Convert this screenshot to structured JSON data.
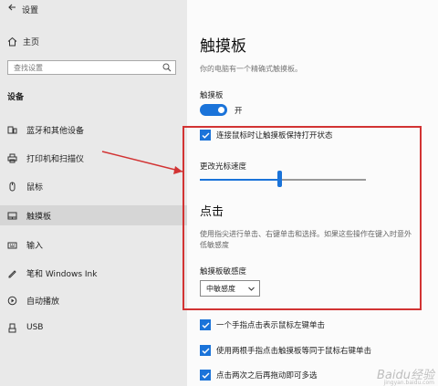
{
  "window": {
    "title": "设置"
  },
  "sidebar": {
    "home": "主页",
    "search_placeholder": "查找设置",
    "section": "设备",
    "items": [
      {
        "label": "蓝牙和其他设备",
        "icon": "bluetooth-devices-icon"
      },
      {
        "label": "打印机和扫描仪",
        "icon": "printer-icon"
      },
      {
        "label": "鼠标",
        "icon": "mouse-icon"
      },
      {
        "label": "触摸板",
        "icon": "touchpad-icon",
        "selected": true
      },
      {
        "label": "输入",
        "icon": "keyboard-icon"
      },
      {
        "label": "笔和 Windows Ink",
        "icon": "pen-icon"
      },
      {
        "label": "自动播放",
        "icon": "autoplay-icon"
      },
      {
        "label": "USB",
        "icon": "usb-icon"
      }
    ]
  },
  "main": {
    "title": "触摸板",
    "subtitle": "你的电脑有一个精确式触摸板。",
    "touchpad_label": "触摸板",
    "toggle_state": "开",
    "keep_on_with_mouse": "连接鼠标时让触摸板保持打开状态",
    "cursor_speed_label": "更改光标速度",
    "cursor_speed_level": 0.48,
    "taps_heading": "点击",
    "taps_desc_line1": "使用指尖进行单击、右键单击和选择。如果这些操作在键入时意外",
    "taps_desc_line2": "低敏感度",
    "sensitivity_label": "触摸板敏感度",
    "sensitivity_value": "中敏感度",
    "checkbox_single_tap": "一个手指点击表示鼠标左键单击",
    "checkbox_two_finger": "使用两根手指点击触摸板等同于鼠标右键单击",
    "checkbox_double_tap": "点击两次之后再拖动即可多选"
  },
  "watermark": {
    "text": "Baidu经验",
    "sub": "jingyan.baidu.com"
  },
  "colors": {
    "accent": "#1a73d9",
    "annotation": "#d23333"
  }
}
